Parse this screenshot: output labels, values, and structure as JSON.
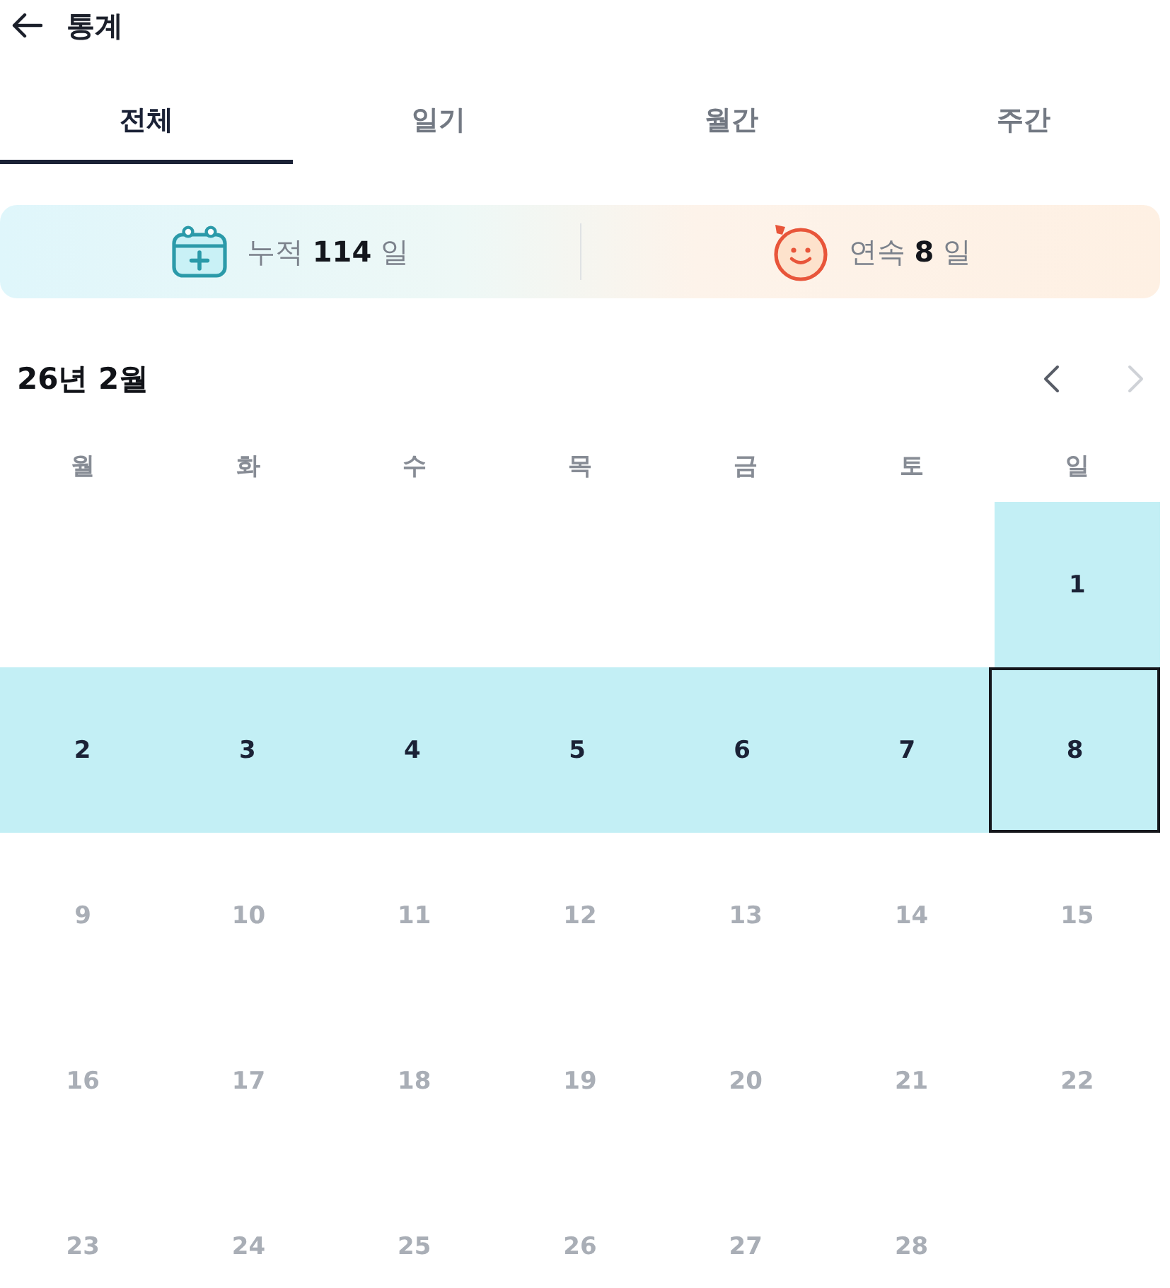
{
  "header": {
    "title": "통계"
  },
  "tabs": [
    {
      "label": "전체",
      "selected": true
    },
    {
      "label": "일기",
      "selected": false
    },
    {
      "label": "월간",
      "selected": false
    },
    {
      "label": "주간",
      "selected": false
    }
  ],
  "stats": [
    {
      "kind": "total",
      "text": "누적 **114** 일"
    },
    {
      "kind": "streak",
      "text": "연속 **8** 일"
    }
  ],
  "calendar": {
    "title": "26년 2월",
    "nav": [
      {
        "kind": "prev",
        "disabled": false
      },
      {
        "kind": "next",
        "disabled": true
      }
    ],
    "weekdays": [
      "월",
      "화",
      "수",
      "목",
      "금",
      "토",
      "일"
    ],
    "weeks": [
      [
        {
          "day": "1",
          "recorded": true,
          "selected": false,
          "disabled": false
        }
      ],
      [
        {
          "day": "2",
          "recorded": true,
          "selected": false,
          "disabled": false
        },
        {
          "day": "3",
          "recorded": true,
          "selected": false,
          "disabled": false
        },
        {
          "day": "4",
          "recorded": true,
          "selected": false,
          "disabled": false
        },
        {
          "day": "5",
          "recorded": true,
          "selected": false,
          "disabled": false
        },
        {
          "day": "6",
          "recorded": true,
          "selected": false,
          "disabled": false
        },
        {
          "day": "7",
          "recorded": true,
          "selected": false,
          "disabled": false
        },
        {
          "day": "8",
          "recorded": true,
          "selected": true,
          "disabled": false
        }
      ],
      [
        {
          "day": "9",
          "recorded": false,
          "selected": false,
          "disabled": true
        },
        {
          "day": "10",
          "recorded": false,
          "selected": false,
          "disabled": true
        },
        {
          "day": "11",
          "recorded": false,
          "selected": false,
          "disabled": true
        },
        {
          "day": "12",
          "recorded": false,
          "selected": false,
          "disabled": true
        },
        {
          "day": "13",
          "recorded": false,
          "selected": false,
          "disabled": true
        },
        {
          "day": "14",
          "recorded": false,
          "selected": false,
          "disabled": true
        },
        {
          "day": "15",
          "recorded": false,
          "selected": false,
          "disabled": true
        }
      ],
      [
        {
          "day": "16",
          "recorded": false,
          "selected": false,
          "disabled": true
        },
        {
          "day": "17",
          "recorded": false,
          "selected": false,
          "disabled": true
        },
        {
          "day": "18",
          "recorded": false,
          "selected": false,
          "disabled": true
        },
        {
          "day": "19",
          "recorded": false,
          "selected": false,
          "disabled": true
        },
        {
          "day": "20",
          "recorded": false,
          "selected": false,
          "disabled": true
        },
        {
          "day": "21",
          "recorded": false,
          "selected": false,
          "disabled": true
        },
        {
          "day": "22",
          "recorded": false,
          "selected": false,
          "disabled": true
        }
      ],
      [
        {
          "day": "23",
          "recorded": false,
          "selected": false,
          "disabled": true
        },
        {
          "day": "24",
          "recorded": false,
          "selected": false,
          "disabled": true
        },
        {
          "day": "25",
          "recorded": false,
          "selected": false,
          "disabled": true
        },
        {
          "day": "26",
          "recorded": false,
          "selected": false,
          "disabled": true
        },
        {
          "day": "27",
          "recorded": false,
          "selected": false,
          "disabled": true
        },
        {
          "day": "28",
          "recorded": false,
          "selected": false,
          "disabled": true
        }
      ]
    ]
  }
}
